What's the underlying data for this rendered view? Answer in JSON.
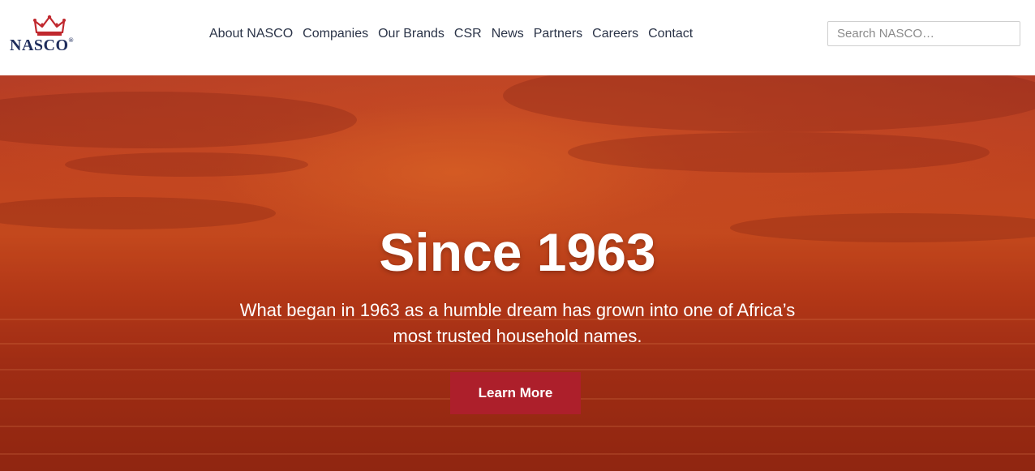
{
  "brand": {
    "name": "NASCO",
    "reg_mark": "®",
    "logo_icon": "crown-icon",
    "crown_color": "#c0282e",
    "text_color": "#1f2d5c"
  },
  "nav": {
    "items": [
      {
        "label": "About NASCO"
      },
      {
        "label": "Companies"
      },
      {
        "label": "Our Brands"
      },
      {
        "label": "CSR"
      },
      {
        "label": "News"
      },
      {
        "label": "Partners"
      },
      {
        "label": "Careers"
      },
      {
        "label": "Contact"
      }
    ]
  },
  "search": {
    "placeholder": "Search NASCO…",
    "value": ""
  },
  "hero": {
    "title": "Since 1963",
    "subtitle": "What began in 1963 as a humble dream has grown into one of Africa’s most trusted household names.",
    "cta_label": "Learn More",
    "cta_color": "#ad1f2b"
  }
}
